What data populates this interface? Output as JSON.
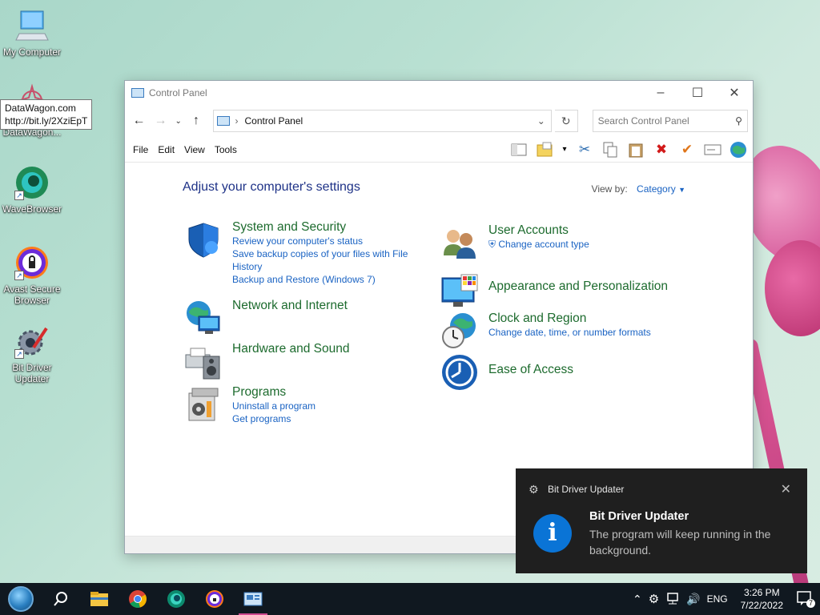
{
  "desktop": {
    "icons": [
      {
        "label": "My Computer",
        "icon": "computer-icon"
      },
      {
        "label": "DataWagon...",
        "icon": "datawagon-icon"
      },
      {
        "label": "WaveBrowser",
        "icon": "wavebrowser-icon"
      },
      {
        "label": "Avast Secure Browser",
        "icon": "avast-browser-icon"
      },
      {
        "label": "Bit Driver Updater",
        "icon": "bit-driver-updater-icon"
      }
    ],
    "tooltip": {
      "line1": "DataWagon.com",
      "line2": "http://bit.ly/2XziEpT"
    }
  },
  "window": {
    "title": "Control Panel",
    "address": "Control Panel",
    "search_placeholder": "Search Control Panel",
    "menu": [
      "File",
      "Edit",
      "View",
      "Tools"
    ],
    "heading": "Adjust your computer's settings",
    "view_by_label": "View by:",
    "view_by_value": "Category",
    "categories_left": [
      {
        "title": "System and Security",
        "icon": "shield-icon",
        "links": [
          "Review your computer's status",
          "Save backup copies of your files with File History",
          "Backup and Restore (Windows 7)"
        ]
      },
      {
        "title": "Network and Internet",
        "icon": "network-globe-icon",
        "links": []
      },
      {
        "title": "Hardware and Sound",
        "icon": "printer-speaker-icon",
        "links": []
      },
      {
        "title": "Programs",
        "icon": "programs-box-icon",
        "links": [
          "Uninstall a program",
          "Get programs"
        ]
      }
    ],
    "categories_right": [
      {
        "title": "User Accounts",
        "icon": "users-icon",
        "links": [
          "Change account type"
        ]
      },
      {
        "title": "Appearance and Personalization",
        "icon": "monitor-palette-icon",
        "links": []
      },
      {
        "title": "Clock and Region",
        "icon": "clock-globe-icon",
        "links": [
          "Change date, time, or number formats"
        ]
      },
      {
        "title": "Ease of Access",
        "icon": "ease-of-access-icon",
        "links": []
      }
    ]
  },
  "toast": {
    "app_name": "Bit Driver Updater",
    "title": "Bit Driver Updater",
    "message": "The program will keep running in the background."
  },
  "taskbar": {
    "apps": [
      "file-explorer-icon",
      "chrome-icon",
      "edge-icon",
      "avast-browser-icon",
      "control-panel-icon"
    ],
    "language": "ENG",
    "time": "3:26 PM",
    "date": "7/22/2022",
    "notification_count": "7"
  }
}
